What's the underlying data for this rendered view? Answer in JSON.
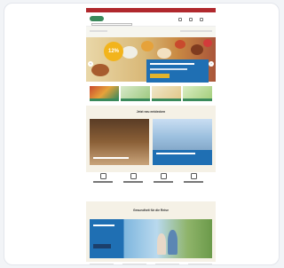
{
  "colors": {
    "brand_green": "#3a8a5b",
    "top_bar_red": "#b0282d",
    "promo_blue": "#1f6fb3",
    "badge_yellow": "#f2b41c",
    "section_beige": "#f5f1e6"
  },
  "icons": [
    "search-icon",
    "user-icon",
    "heart-icon",
    "cart-icon",
    "chevron-left-icon",
    "chevron-right-icon",
    "pharmacy-icon",
    "truck-icon",
    "percent-icon",
    "phone-icon"
  ],
  "hero": {
    "badge_text": "12%"
  },
  "sections": {
    "inspiration_title": "Jetzt neu entdecken",
    "travel_title": "Gesundheit für die Reise"
  }
}
